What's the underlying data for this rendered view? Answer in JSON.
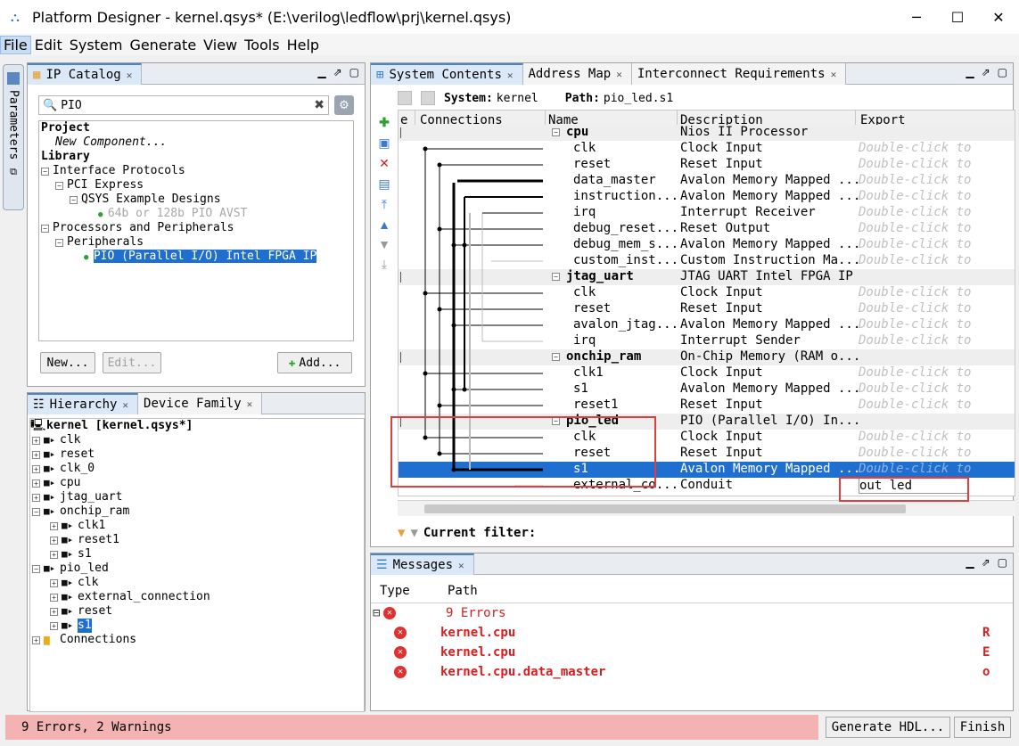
{
  "window": {
    "title": "Platform Designer - kernel.qsys* (E:\\verilog\\ledflow\\prj\\kernel.qsys)",
    "minimize": "─",
    "maximize": "☐",
    "close": "✕"
  },
  "menu": [
    "File",
    "Edit",
    "System",
    "Generate",
    "View",
    "Tools",
    "Help"
  ],
  "params_tab": {
    "label": "Parameters"
  },
  "ip_catalog": {
    "tab_label": "IP Catalog",
    "search_value": "PIO",
    "tree": [
      {
        "text": "Project",
        "bold": true,
        "indent": 0
      },
      {
        "text": "New Component...",
        "italic": true,
        "indent": 1
      },
      {
        "text": "Library",
        "bold": true,
        "indent": 0
      },
      {
        "text": "Interface Protocols",
        "indent": 0,
        "pm": "−"
      },
      {
        "text": "PCI Express",
        "indent": 1,
        "pm": "−"
      },
      {
        "text": "QSYS Example Designs",
        "indent": 2,
        "pm": "−"
      },
      {
        "text": "64b or 128b PIO AVST",
        "indent": 4,
        "dim": true,
        "dot": true
      },
      {
        "text": "Processors and Peripherals",
        "indent": 0,
        "pm": "−"
      },
      {
        "text": "Peripherals",
        "indent": 1,
        "pm": "−"
      },
      {
        "text": "PIO (Parallel I/O) Intel FPGA IP",
        "indent": 3,
        "selected": true,
        "dot": true
      }
    ],
    "new_button": "New...",
    "edit_button": "Edit...",
    "add_button": "Add..."
  },
  "hierarchy": {
    "tab_label": "Hierarchy",
    "tab2_label": "Device Family",
    "root": "kernel [kernel.qsys*]",
    "items": [
      {
        "text": "clk",
        "indent": 1
      },
      {
        "text": "reset",
        "indent": 1
      },
      {
        "text": "clk_0",
        "indent": 1
      },
      {
        "text": "cpu",
        "indent": 1
      },
      {
        "text": "jtag_uart",
        "indent": 1
      },
      {
        "text": "onchip_ram",
        "indent": 1,
        "open": true
      },
      {
        "text": "clk1",
        "indent": 2
      },
      {
        "text": "reset1",
        "indent": 2
      },
      {
        "text": "s1",
        "indent": 2
      },
      {
        "text": "pio_led",
        "indent": 1,
        "open": true
      },
      {
        "text": "clk",
        "indent": 2
      },
      {
        "text": "external_connection",
        "indent": 2
      },
      {
        "text": "reset",
        "indent": 2
      },
      {
        "text": "s1",
        "indent": 2,
        "selected": true
      },
      {
        "text": "Connections",
        "indent": 1,
        "folder": true
      }
    ]
  },
  "system": {
    "tabs": [
      "System Contents",
      "Address Map",
      "Interconnect Requirements"
    ],
    "system_label": "System:",
    "system_value": "kernel",
    "path_label": "Path:",
    "path_value": "pio_led.s1",
    "columns": [
      "e",
      "Connections",
      "Name",
      "Description",
      "Export"
    ],
    "rows": [
      {
        "name": "cpu",
        "desc": "Nios II Processor",
        "export": "",
        "comp": true
      },
      {
        "name": "clk",
        "desc": "Clock Input",
        "export": "Double-click to"
      },
      {
        "name": "reset",
        "desc": "Reset Input",
        "export": "Double-click to"
      },
      {
        "name": "data_master",
        "desc": "Avalon Memory Mapped ...",
        "export": "Double-click to"
      },
      {
        "name": "instruction...",
        "desc": "Avalon Memory Mapped ...",
        "export": "Double-click to"
      },
      {
        "name": "irq",
        "desc": "Interrupt Receiver",
        "export": "Double-click to"
      },
      {
        "name": "debug_reset...",
        "desc": "Reset Output",
        "export": "Double-click to"
      },
      {
        "name": "debug_mem_s...",
        "desc": "Avalon Memory Mapped ...",
        "export": "Double-click to"
      },
      {
        "name": "custom_inst...",
        "desc": "Custom Instruction Ma...",
        "export": "Double-click to"
      },
      {
        "name": "jtag_uart",
        "desc": "JTAG UART Intel FPGA IP",
        "export": "",
        "comp": true
      },
      {
        "name": "clk",
        "desc": "Clock Input",
        "export": "Double-click to"
      },
      {
        "name": "reset",
        "desc": "Reset Input",
        "export": "Double-click to"
      },
      {
        "name": "avalon_jtag...",
        "desc": "Avalon Memory Mapped ...",
        "export": "Double-click to"
      },
      {
        "name": "irq",
        "desc": "Interrupt Sender",
        "export": "Double-click to"
      },
      {
        "name": "onchip_ram",
        "desc": "On-Chip Memory (RAM o...",
        "export": "",
        "comp": true
      },
      {
        "name": "clk1",
        "desc": "Clock Input",
        "export": "Double-click to"
      },
      {
        "name": "s1",
        "desc": "Avalon Memory Mapped ...",
        "export": "Double-click to"
      },
      {
        "name": "reset1",
        "desc": "Reset Input",
        "export": "Double-click to"
      },
      {
        "name": "pio_led",
        "desc": "PIO (Parallel I/O) In...",
        "export": "",
        "comp": true
      },
      {
        "name": "clk",
        "desc": "Clock Input",
        "export": "Double-click to"
      },
      {
        "name": "reset",
        "desc": "Reset Input",
        "export": "Double-click to"
      },
      {
        "name": "s1",
        "desc": "Avalon Memory Mapped ...",
        "export": "Double-click to",
        "selected": true
      },
      {
        "name": "external_co...",
        "desc": "Conduit",
        "export": "out led",
        "edit": true
      }
    ],
    "filter_label": "Current filter:"
  },
  "messages": {
    "tab_label": "Messages",
    "col_type": "Type",
    "col_path": "Path",
    "summary": "9 Errors",
    "rows": [
      {
        "path": "kernel.cpu",
        "right": "R"
      },
      {
        "path": "kernel.cpu",
        "right": "E"
      },
      {
        "path": "kernel.cpu.data_master",
        "right": "o"
      }
    ]
  },
  "status": {
    "text": "9 Errors, 2 Warnings",
    "generate_button": "Generate HDL...",
    "finish_button": "Finish"
  }
}
